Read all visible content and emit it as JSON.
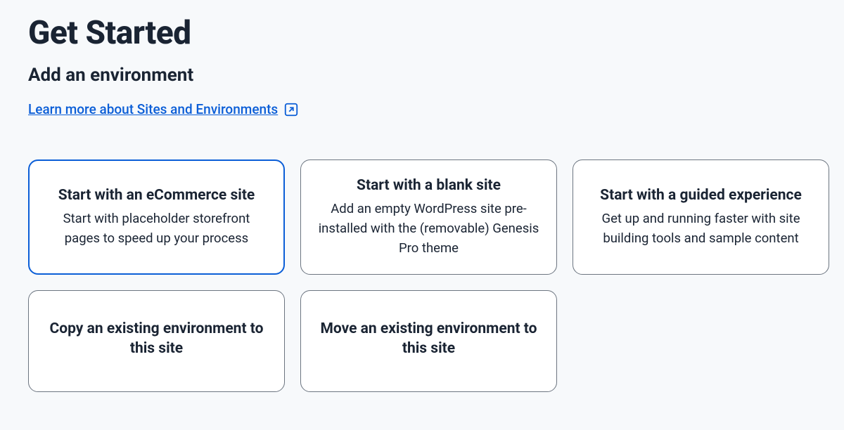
{
  "page": {
    "title": "Get Started",
    "section_title": "Add an environment",
    "learn_link": "Learn more about Sites and Environments"
  },
  "cards": {
    "ecommerce": {
      "title": "Start with an eCommerce site",
      "desc": "Start with placeholder storefront pages to speed up your process"
    },
    "blank": {
      "title": "Start with a blank site",
      "desc": "Add an empty WordPress site pre-installed with the (removable) Genesis Pro theme"
    },
    "guided": {
      "title": "Start with a guided experience",
      "desc": "Get up and running faster with site building tools and sample content"
    },
    "copy": {
      "title": "Copy an existing environment to this site"
    },
    "move": {
      "title": "Move an existing environment to this site"
    }
  }
}
